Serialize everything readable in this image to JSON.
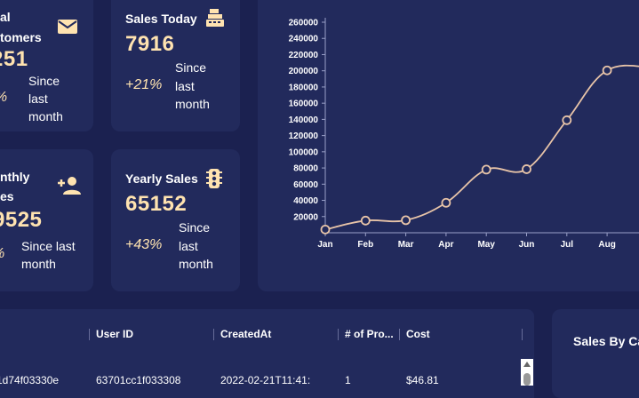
{
  "cards": {
    "total_customers": {
      "title_line1": "al",
      "title_line2": "tomers",
      "value": "251",
      "pct": "4%",
      "since": [
        "Since",
        "last",
        "month"
      ]
    },
    "sales_today": {
      "title": "Sales Today",
      "value": "7916",
      "pct": "+21%",
      "since": [
        "Since",
        "last",
        "month"
      ]
    },
    "monthly_sales": {
      "title_line1": "nthly",
      "title_line2": "es",
      "value": "9525",
      "pct": "%",
      "since": [
        "Since last",
        "month"
      ]
    },
    "yearly_sales": {
      "title": "Yearly Sales",
      "value": "65152",
      "pct": "+43%",
      "since": [
        "Since",
        "last",
        "month"
      ]
    }
  },
  "chart_data": {
    "type": "line",
    "categories": [
      "Jan",
      "Feb",
      "Mar",
      "Apr",
      "May",
      "Jun",
      "Jul",
      "Aug"
    ],
    "values": [
      4000,
      15000,
      15500,
      37000,
      78000,
      78500,
      139000,
      200500
    ],
    "ylim": [
      0,
      260000
    ],
    "yticks": [
      "20000",
      "40000",
      "60000",
      "80000",
      "100000",
      "120000",
      "140000",
      "160000",
      "180000",
      "200000",
      "220000",
      "240000",
      "260000"
    ]
  },
  "table": {
    "columns": [
      "User ID",
      "CreatedAt",
      "# of Pro...",
      "Cost"
    ],
    "row_partial": [
      "1d74f03330e",
      "63701cc1f033308",
      "2022-02-21T11:41:",
      "1",
      "$46.81"
    ]
  },
  "pie_panel": {
    "title": "Sales By Ca"
  },
  "colors": {
    "background": "#1b2150",
    "card": "#222a5c",
    "accent": "#ffe3b0",
    "line": "#e8c4a8"
  }
}
